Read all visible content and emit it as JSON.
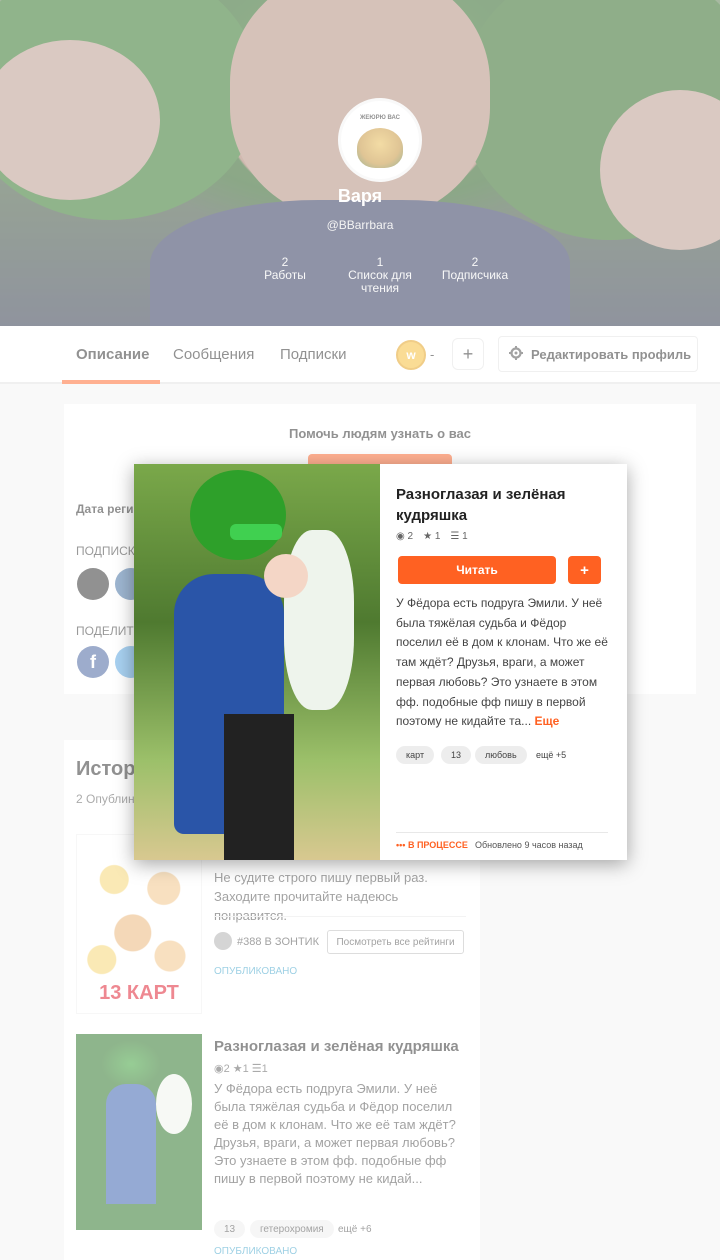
{
  "profile": {
    "avatar_caption": "ЖЕЮРЮ ВАС",
    "name": "Варя",
    "handle": "@BBarrbara",
    "stats": [
      {
        "value": "2",
        "label": "Работы"
      },
      {
        "value": "1",
        "label": "Список для чтения"
      },
      {
        "value": "2",
        "label": "Подписчика"
      }
    ]
  },
  "tabs": [
    "Описание",
    "Сообщения",
    "Подписки"
  ],
  "coins": {
    "symbol": "w",
    "value": "-"
  },
  "add_label": "+",
  "edit_profile_label": "Редактировать профиль",
  "about": {
    "help_text": "Помочь людям узнать о вас",
    "reg_label": "Дата реги",
    "following_label": "ПОДПИСК",
    "share_label": "ПОДЕЛИТ",
    "fb_letter": "f"
  },
  "stories": {
    "title": "Истор",
    "subtitle": "2 Опублин",
    "items": [
      {
        "cover_text": "13 КАРТ",
        "description": "Не судите строго пишу первый раз. Заходите прочитайте надеюсь понравится.",
        "rank_text": "#388 В ЗОНТИК",
        "ratings_button": "Посмотреть все рейтинги",
        "status": "ОПУБЛИКОВАНО"
      },
      {
        "title": "Разноглазая и зелёная кудряшка",
        "meta": "◉2 ★1 ☰1",
        "description": "У Фёдора есть подруга Эмили. У неё была тяжёлая судьба и Фёдор поселил её в дом к клонам. Что же её там ждёт? Друзья, враги, а может первая любовь? Это узнаете в этом фф. подобные фф пишу в первой поэтому не кидай...",
        "tags": [
          "13",
          "гетерохромия"
        ],
        "more_tags": "ещё +6",
        "status": "ОПУБЛИКОВАНО"
      }
    ]
  },
  "modal": {
    "close": "✕",
    "title": "Разноглазая и зелёная кудряшка",
    "stats": {
      "views": "2",
      "votes": "1",
      "parts": "1"
    },
    "read_label": "Читать",
    "add_label": "+",
    "description": "У Фёдора есть подруга Эмили. У неё была тяжёлая судьба и Фёдор поселил её в дом к клонам. Что же её там ждёт? Друзья, враги, а может первая любовь? Это узнаете в этом фф. подобные фф пишу в первой поэтому не кидайте та...",
    "more_label": "Еще",
    "tags": [
      "карт",
      "13",
      "любовь"
    ],
    "more_tags": "ещё +5",
    "status": "••• В ПРОЦЕССЕ",
    "updated": "Обновлено 9 часов назад"
  },
  "colors": {
    "accent": "#ff6122",
    "link": "#3aa0c8"
  }
}
